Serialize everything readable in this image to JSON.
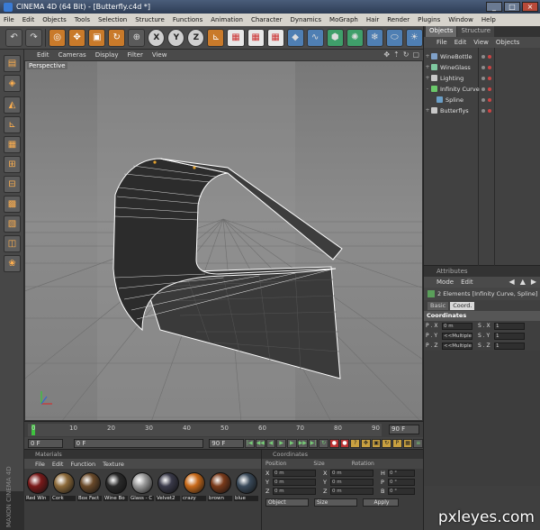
{
  "window": {
    "title": "CINEMA 4D (64 Bit) - [Butterfly.c4d *]"
  },
  "menubar": [
    "File",
    "Edit",
    "Objects",
    "Tools",
    "Selection",
    "Structure",
    "Functions",
    "Animation",
    "Character",
    "Dynamics",
    "MoGraph",
    "Hair",
    "Render",
    "Plugins",
    "Window",
    "Help"
  ],
  "viewport": {
    "menu": [
      "Edit",
      "Cameras",
      "Display",
      "Filter",
      "View"
    ],
    "label": "Perspective"
  },
  "timeline": {
    "ticks": [
      "0",
      "10",
      "20",
      "30",
      "40",
      "50",
      "60",
      "70",
      "80",
      "90"
    ],
    "end_frame": "90 F"
  },
  "transport": {
    "current_frame": "0 F",
    "start_field": "0 F",
    "end_field": "90 F"
  },
  "objects_panel": {
    "tabs": [
      "Objects",
      "Structure"
    ],
    "menu": [
      "File",
      "Edit",
      "View",
      "Objects"
    ],
    "items": [
      {
        "name": "WineBottle",
        "color": "#7fa0c8",
        "expand": "+",
        "indent": 0
      },
      {
        "name": "WineGlass",
        "color": "#7fc8a0",
        "expand": "+",
        "indent": 0
      },
      {
        "name": "Lighting",
        "color": "#c8c8c8",
        "expand": "+",
        "indent": 0
      },
      {
        "name": "Infinity Curve",
        "color": "#6ac86a",
        "expand": "-",
        "indent": 0
      },
      {
        "name": "Spline",
        "color": "#6a9fc8",
        "expand": "",
        "indent": 1
      },
      {
        "name": "Butterflys",
        "color": "#c8c8c8",
        "expand": "+",
        "indent": 0
      }
    ]
  },
  "attributes": {
    "title": "Attributes",
    "menu": [
      "Mode",
      "Edit"
    ],
    "info": "2 Elements [Infinity Curve, Spline]",
    "tabs": [
      "Basic",
      "Coord."
    ],
    "section": "Coordinates",
    "rows": [
      {
        "a": "P . X",
        "v": "0 m",
        "b": "S . X",
        "s": "1"
      },
      {
        "a": "P . Y",
        "v": "<<Multiple",
        "b": "S . Y",
        "s": "1"
      },
      {
        "a": "P . Z",
        "v": "<<Multiple",
        "b": "S . Z",
        "s": "1"
      }
    ]
  },
  "materials": {
    "title": "Materials",
    "menu": [
      "File",
      "Edit",
      "Function",
      "Texture"
    ],
    "items": [
      {
        "label": "Red Win",
        "color": "#7a1a1a"
      },
      {
        "label": "Cork",
        "color": "#8c6a3a"
      },
      {
        "label": "Box Fact",
        "color": "#6a4a2a"
      },
      {
        "label": "Wine Bo",
        "color": "#2a2a2a"
      },
      {
        "label": "Glass - C",
        "color": "#9a9a9a"
      },
      {
        "label": "Velvet2",
        "color": "#3a3a4a"
      },
      {
        "label": "crazy",
        "color": "#c86a1a"
      },
      {
        "label": "brown",
        "color": "#7a3a1a"
      },
      {
        "label": "blue",
        "color": "#3a4a5a"
      }
    ]
  },
  "coordinates": {
    "title": "Coordinates",
    "headers": [
      "Position",
      "Size",
      "Rotation"
    ],
    "rows": [
      {
        "l1": "X",
        "v1": "0 m",
        "l2": "X",
        "v2": "0 m",
        "l3": "H",
        "v3": "0 °"
      },
      {
        "l1": "Y",
        "v1": "0 m",
        "l2": "Y",
        "v2": "0 m",
        "l3": "P",
        "v3": "0 °"
      },
      {
        "l1": "Z",
        "v1": "0 m",
        "l2": "Z",
        "v2": "0 m",
        "l3": "B",
        "v3": "0 °"
      }
    ],
    "mode1": "Object",
    "mode2": "Size",
    "apply": "Apply"
  },
  "branding": {
    "vertical": "MAXON CINEMA 4D"
  },
  "watermark": "pxleyes.com",
  "colors": {
    "accent": "#c97a2a",
    "viewport_bg": "#8a8a8a",
    "panel_bg": "#3f3f3f"
  }
}
